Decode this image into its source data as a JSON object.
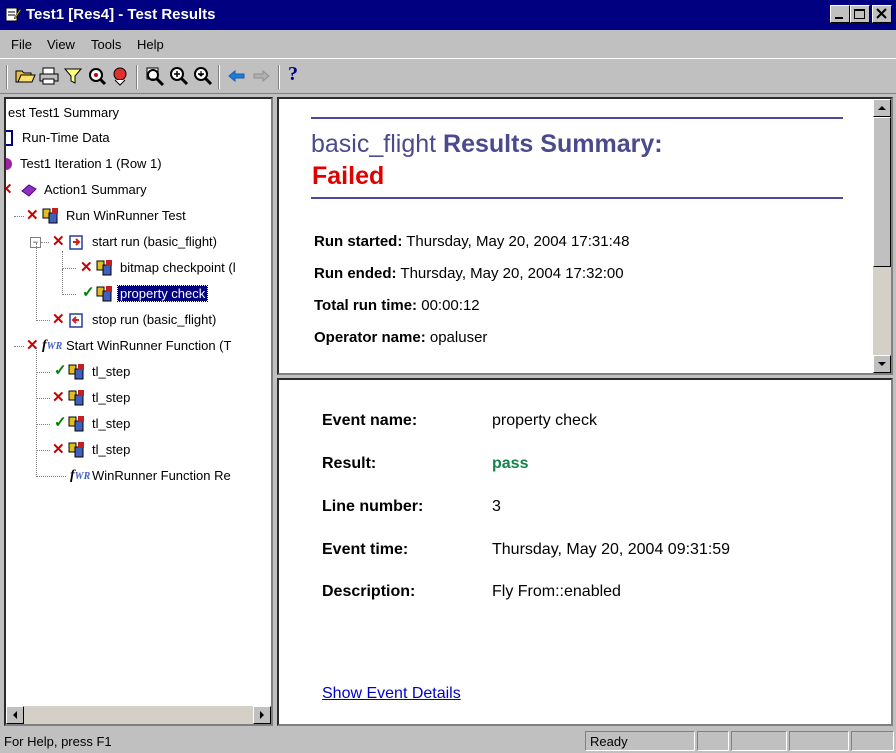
{
  "window": {
    "title": "Test1 [Res4] - Test Results"
  },
  "menu": [
    "File",
    "View",
    "Tools",
    "Help"
  ],
  "toolbar": {
    "icons": [
      "open-icon",
      "print-icon",
      "filter-icon",
      "find-icon",
      "bookmark-icon",
      "zoom-icon",
      "zoom-in-icon",
      "zoom-out-icon",
      "back-icon",
      "forward-icon",
      "help-icon"
    ],
    "help_glyph": "?"
  },
  "tree": {
    "items": [
      {
        "label": "est Test1 Summary",
        "status": "none"
      },
      {
        "label": "Run-Time Data",
        "status": "none"
      },
      {
        "label": "Test1 Iteration 1 (Row 1)",
        "status": "none"
      },
      {
        "label": "Action1 Summary",
        "status": "fail"
      },
      {
        "label": "Run WinRunner Test",
        "status": "fail"
      },
      {
        "label": "start run (basic_flight)",
        "status": "fail"
      },
      {
        "label": "bitmap checkpoint (l",
        "status": "fail"
      },
      {
        "label": "property check",
        "status": "pass"
      },
      {
        "label": "stop run (basic_flight)",
        "status": "fail"
      },
      {
        "label": "Start WinRunner Function (T",
        "status": "fail"
      },
      {
        "label": "tl_step",
        "status": "pass"
      },
      {
        "label": "tl_step",
        "status": "fail"
      },
      {
        "label": "tl_step",
        "status": "pass"
      },
      {
        "label": "tl_step",
        "status": "fail"
      },
      {
        "label": "WinRunner Function Re",
        "status": "none"
      }
    ]
  },
  "summary": {
    "test_name": "basic_flight",
    "heading": "Results Summary:",
    "status": "Failed",
    "fields": [
      {
        "key": "Run started:",
        "value": "Thursday, May 20, 2004 17:31:48"
      },
      {
        "key": "Run ended:",
        "value": "Thursday, May 20, 2004 17:32:00"
      },
      {
        "key": "Total run time:",
        "value": "00:00:12"
      },
      {
        "key": "Operator name:",
        "value": "opaluser"
      }
    ]
  },
  "event": {
    "fields": [
      {
        "key": "Event name:",
        "value": "property check"
      },
      {
        "key": "Result:",
        "value": "pass"
      },
      {
        "key": "Line number:",
        "value": "3"
      },
      {
        "key": "Event time:",
        "value": "Thursday, May 20, 2004 09:31:59"
      },
      {
        "key": "Description:",
        "value": "Fly From::enabled"
      }
    ],
    "details_link": "Show Event Details"
  },
  "status": {
    "help_text": "For Help, press F1",
    "state": "Ready"
  },
  "colors": {
    "title_bar": "#000080",
    "failed": "#e00000",
    "pass": "#14824a",
    "heading": "#4a4a8c",
    "link": "#0000cc"
  }
}
